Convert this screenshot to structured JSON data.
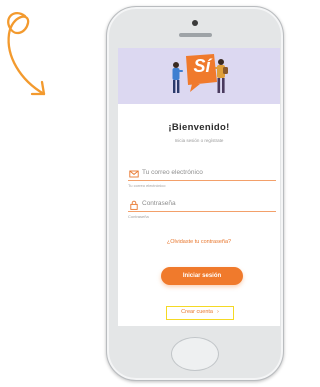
{
  "colors": {
    "accent": "#f07a2c",
    "hero_background": "#dcd8f1",
    "highlight_outline": "#f4d924"
  },
  "hero": {
    "logo_text": "Sí"
  },
  "login": {
    "welcome_title": "¡Bienvenido!",
    "subtitle": "Inicia sesión o regístrate",
    "email": {
      "placeholder": "Tu correo electrónico",
      "helper": "Tu correo electrónico",
      "icon": "envelope-icon"
    },
    "password": {
      "placeholder": "Contraseña",
      "helper": "Contraseña",
      "icon": "lock-icon"
    },
    "forgot_link": "¿Olvidaste tu contraseña?",
    "login_button": "Iniciar sesión",
    "create_account": "Crear cuenta",
    "create_account_chevron": "›"
  }
}
